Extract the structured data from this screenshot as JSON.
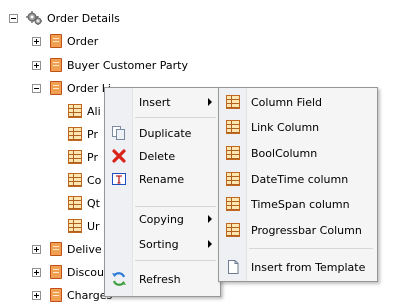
{
  "tree": {
    "root": "Order Details",
    "children": [
      {
        "label": "Order",
        "expanded": false
      },
      {
        "label": "Buyer Customer Party",
        "expanded": false
      },
      {
        "label": "OrderLines",
        "expanded": true,
        "shown": "Order Li"
      },
      {
        "label": "Delive",
        "expanded": false
      },
      {
        "label": "Discou",
        "expanded": false
      },
      {
        "label": "Charges",
        "expanded": false
      }
    ],
    "sub_children": [
      "Ali",
      "Pr",
      "Pr",
      "Co",
      "Qt",
      "Ur"
    ]
  },
  "context_menu": {
    "items": [
      {
        "label": "Insert",
        "icon": "none",
        "submenu": true
      },
      {
        "label": "Duplicate",
        "icon": "duplicate-icon",
        "submenu": false
      },
      {
        "label": "Delete",
        "icon": "delete-x-icon",
        "submenu": false
      },
      {
        "label": "Rename",
        "icon": "rename-icon",
        "submenu": false
      },
      {
        "label": "Copying",
        "icon": "none",
        "submenu": true
      },
      {
        "label": "Sorting",
        "icon": "none",
        "submenu": true
      },
      {
        "label": "Refresh",
        "icon": "refresh-icon",
        "submenu": false
      }
    ]
  },
  "insert_submenu": {
    "items": [
      {
        "label": "Column Field",
        "icon": "grid-icon"
      },
      {
        "label": "Link Column",
        "icon": "grid-icon"
      },
      {
        "label": "BoolColumn",
        "icon": "grid-icon"
      },
      {
        "label": "DateTime column",
        "icon": "grid-icon"
      },
      {
        "label": "TimeSpan column",
        "icon": "grid-icon"
      },
      {
        "label": "Progressbar Column",
        "icon": "grid-icon"
      },
      {
        "label": "Insert from Template",
        "icon": "template-icon"
      }
    ]
  },
  "colors": {
    "delete_x": "#d8231b",
    "rename_icon": "#2050c0",
    "refresh_icon": "#2f7bd6"
  }
}
